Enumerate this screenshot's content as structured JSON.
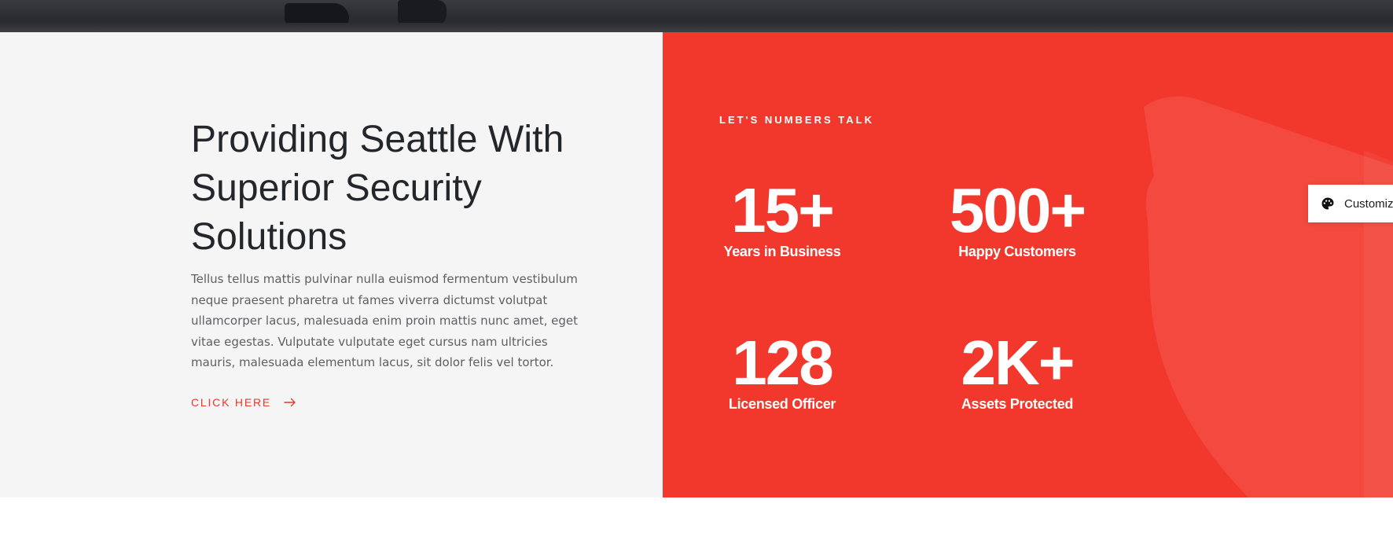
{
  "about": {
    "headline": "Providing Seattle With Superior Security Solutions",
    "body": "Tellus tellus mattis pulvinar nulla euismod fermentum vestibulum neque praesent pharetra ut fames viverra dictumst volutpat ullamcorper lacus, malesuada enim proin mattis nunc amet, eget vitae egestas. Vulputate vulputate eget cursus nam ultricies mauris, malesuada elementum lacus, sit dolor felis vel tortor.",
    "cta_label": "CLICK HERE",
    "cta_icon": "arrow-right-icon"
  },
  "stats_panel": {
    "eyebrow": "LET'S NUMBERS TALK",
    "stats": [
      {
        "value": "15+",
        "label": "Years in Business"
      },
      {
        "value": "500+",
        "label": "Happy Customers"
      },
      {
        "value": "128",
        "label": "Licensed Officer"
      },
      {
        "value": "2K+",
        "label": "Assets Protected"
      }
    ]
  },
  "customize": {
    "label": "Customiz",
    "icon": "palette-icon"
  },
  "colors": {
    "accent": "#f2382d",
    "cta": "#e8392d",
    "left_bg": "#f5f5f5",
    "heading": "#23262b",
    "body": "#5e5f63"
  }
}
